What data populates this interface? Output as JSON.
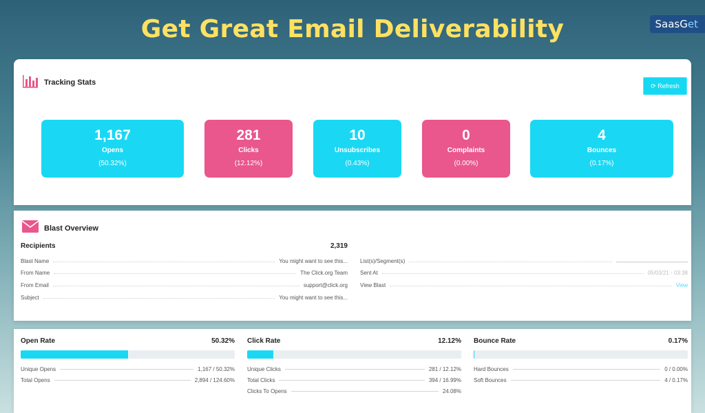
{
  "headline": "Get Great Email Deliverability",
  "brand": {
    "part1": "SaasG",
    "part2": "et"
  },
  "tracking": {
    "title": "Tracking Stats",
    "refresh_label": "⟳ Refresh",
    "stats": [
      {
        "value": "1,167",
        "label": "Opens",
        "percent": "(50.32%)",
        "color": "#1ad8f4"
      },
      {
        "value": "281",
        "label": "Clicks",
        "percent": "(12.12%)",
        "color": "#e9578c"
      },
      {
        "value": "10",
        "label": "Unsubscribes",
        "percent": "(0.43%)",
        "color": "#1ad8f4"
      },
      {
        "value": "0",
        "label": "Complaints",
        "percent": "(0.00%)",
        "color": "#e9578c"
      },
      {
        "value": "4",
        "label": "Bounces",
        "percent": "(0.17%)",
        "color": "#1ad8f4"
      }
    ]
  },
  "blast": {
    "title": "Blast Overview",
    "recipients_label": "Recipients",
    "recipients_value": "2,319",
    "left_rows": [
      {
        "label": "Blast Name",
        "value": "You might want to see this..."
      },
      {
        "label": "From Name",
        "value": "The Click.org Team"
      },
      {
        "label": "From Email",
        "value": "support@click.org"
      },
      {
        "label": "Subject",
        "value": "You might want to see this..."
      }
    ],
    "right_rows": [
      {
        "label": "List(s)/Segment(s)",
        "value": "▬▬▬▬▬▬▬▬▬▬▬▬▬"
      },
      {
        "label": "Sent At",
        "value": "05/03/21 - 03:38"
      },
      {
        "label": "View Blast",
        "value": "View"
      }
    ]
  },
  "rates": {
    "open": {
      "title": "Open Rate",
      "value": "50.32%",
      "fill": 0.5032,
      "rows": [
        {
          "label": "Unique Opens",
          "value": "1,167 / 50.32%"
        },
        {
          "label": "Total Opens",
          "value": "2,894 / 124.60%"
        }
      ]
    },
    "click": {
      "title": "Click Rate",
      "value": "12.12%",
      "fill": 0.1212,
      "rows": [
        {
          "label": "Unique Clicks",
          "value": "281 / 12.12%"
        },
        {
          "label": "Total Clicks",
          "value": "394 / 16.99%"
        },
        {
          "label": "Clicks To Opens",
          "value": "24.08%"
        }
      ]
    },
    "bounce": {
      "title": "Bounce Rate",
      "value": "0.17%",
      "fill": 0.0017,
      "rows": [
        {
          "label": "Hard Bounces",
          "value": "0 / 0.00%"
        },
        {
          "label": "Soft Bounces",
          "value": "4 / 0.17%"
        }
      ]
    }
  }
}
